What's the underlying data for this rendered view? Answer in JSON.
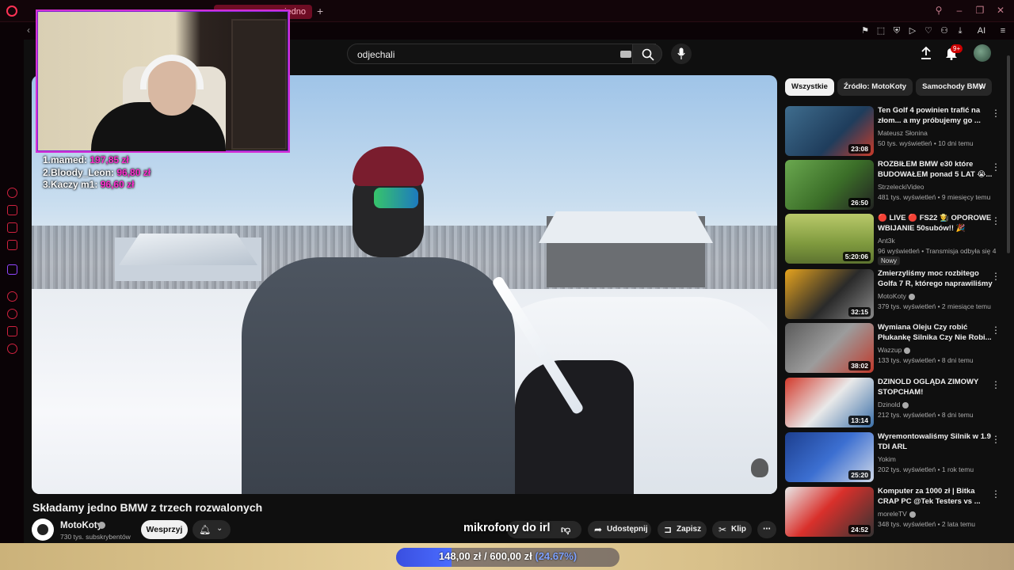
{
  "browser": {
    "active_tab": "jedno",
    "new_tab": "+",
    "ai_label": "AI"
  },
  "search": {
    "query": "odjechali"
  },
  "notifications": {
    "badge": "9+"
  },
  "stream_overlay": {
    "donors": [
      {
        "rank": "1.",
        "name": "mamed:",
        "amount": "197,85 zł"
      },
      {
        "rank": "2.",
        "name": "Bloody_Leon:",
        "amount": "96,80 zł"
      },
      {
        "rank": "3.",
        "name": "Kaczy m1:",
        "amount": "96,60 zł"
      }
    ],
    "mic_text": "mikrofony do irl",
    "goal": {
      "current": "148,00 zł",
      "separator": "/",
      "target": "600,00 zł",
      "percent_label": "(24.67%)",
      "progress": 0.2467
    }
  },
  "video": {
    "title": "Składamy jedno BMW z trzech rozwalonych",
    "channel": "MotoKoty",
    "subscribers": "730 tys. subskrybentów",
    "support_label": "Wesprzyj",
    "share_label": "Udostępnij",
    "save_label": "Zapisz",
    "clip_label": "Klip"
  },
  "chips": [
    "Wszystkie",
    "Źródło: MotoKoty",
    "Samochody BMW"
  ],
  "recommendations": [
    {
      "title": "Ten Golf 4 powinien trafić na złom... a my próbujemy go ...",
      "channel": "Mateusz Słonina",
      "meta": "50 tys. wyświetleń • 10 dni temu",
      "duration": "23:08",
      "verified": false,
      "badge": "",
      "thumb": "linear-gradient(135deg,#3f6d8e,#1f3d5c 60%,#c73b2a)"
    },
    {
      "title": "ROZBIŁEM BMW e30 które BUDOWAŁEM ponad 5 LAT 😭...",
      "channel": "StrzeleckiVideo",
      "meta": "481 tys. wyświetleń • 9 miesięcy temu",
      "duration": "26:50",
      "verified": false,
      "badge": "",
      "thumb": "linear-gradient(135deg,#6aa84f,#3b6e28 55%,#222)"
    },
    {
      "title": "🔴 LIVE 🔴 FS22 👨‍🌾 OPOROWE WBIJANIE 50subów!! 🎉",
      "channel": "Ant3k",
      "meta": "96 wyświetleń • Transmisja odbyła się 4 ...",
      "duration": "5:20:06",
      "verified": false,
      "badge": "Nowy",
      "thumb": "linear-gradient(180deg,#b9c96a,#7f9a3e 60%,#5d7330)"
    },
    {
      "title": "Zmierzyliśmy moc rozbitego Golfa 7 R, którego naprawiliśmy",
      "channel": "MotoKoty",
      "meta": "379 tys. wyświetleń • 2 miesiące temu",
      "duration": "32:15",
      "verified": true,
      "badge": "",
      "thumb": "linear-gradient(135deg,#e6a31e,#2a2a2a 55%,#8a8a8a)"
    },
    {
      "title": "Wymiana Oleju Czy robić Płukankę Silnika Czy Nie Robi...",
      "channel": "Wazzup",
      "meta": "133 tys. wyświetleń • 8 dni temu",
      "duration": "38:02",
      "verified": true,
      "badge": "",
      "thumb": "linear-gradient(135deg,#5a5a5a,#9c9c9c 50%,#c0392b)"
    },
    {
      "title": "DZINOLD OGLĄDA ZIMOWY STOPCHAM!",
      "channel": "Dzinold",
      "meta": "212 tys. wyświetleń • 8 dni temu",
      "duration": "13:14",
      "verified": true,
      "badge": "",
      "thumb": "linear-gradient(135deg,#d33a2c,#e9e9e9 50%,#3b6fa8)"
    },
    {
      "title": "Wyremontowaliśmy Silnik w 1.9 TDI ARL",
      "channel": "Yokim",
      "meta": "202 tys. wyświetleń • 1 rok temu",
      "duration": "25:20",
      "verified": false,
      "badge": "",
      "thumb": "linear-gradient(135deg,#1d3f8f,#3c6fd1 50%,#cfd8e8)"
    },
    {
      "title": "Komputer za 1000 zł | Bitka CRAP PC @Tek Testers vs ...",
      "channel": "moreleTV",
      "meta": "348 tys. wyświetleń • 2 lata temu",
      "duration": "24:52",
      "verified": true,
      "badge": "",
      "thumb": "linear-gradient(135deg,#e8e8e8,#d9302b 45%,#333)"
    }
  ]
}
